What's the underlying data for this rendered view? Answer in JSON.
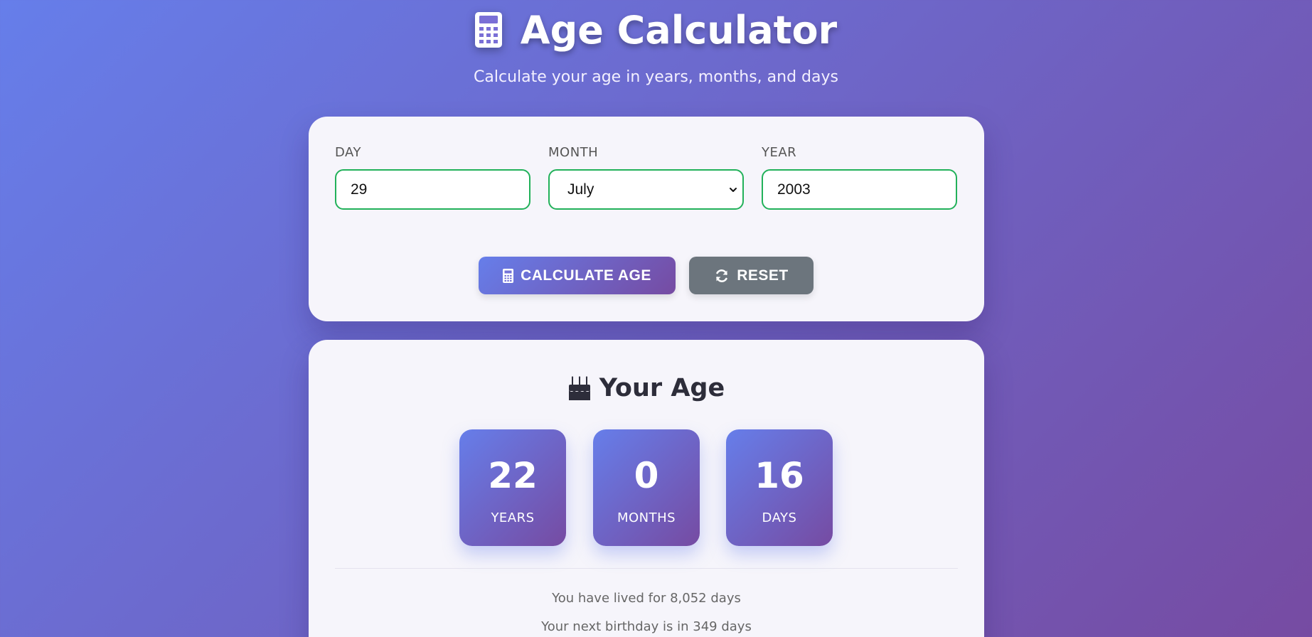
{
  "header": {
    "title": "Age Calculator",
    "subtitle": "Calculate your age in years, months, and days",
    "icon": "calculator-icon"
  },
  "form": {
    "day": {
      "label": "DAY",
      "value": "29"
    },
    "month": {
      "label": "MONTH",
      "value": "July"
    },
    "year": {
      "label": "YEAR",
      "value": "2003"
    },
    "calculate_label": "CALCULATE AGE",
    "reset_label": "RESET",
    "field_border_color": "#22b15a"
  },
  "result": {
    "title": "Your Age",
    "title_icon": "birthday-cake-icon",
    "years": {
      "value": "22",
      "label": "YEARS"
    },
    "months": {
      "value": "0",
      "label": "MONTHS"
    },
    "days": {
      "value": "16",
      "label": "DAYS"
    },
    "lived_text": "You have lived for 8,052 days",
    "next_birthday_text": "Your next birthday is in 349 days"
  },
  "colors": {
    "gradient_start": "#667eea",
    "gradient_end": "#764ba2",
    "reset_button": "#6c757d"
  }
}
